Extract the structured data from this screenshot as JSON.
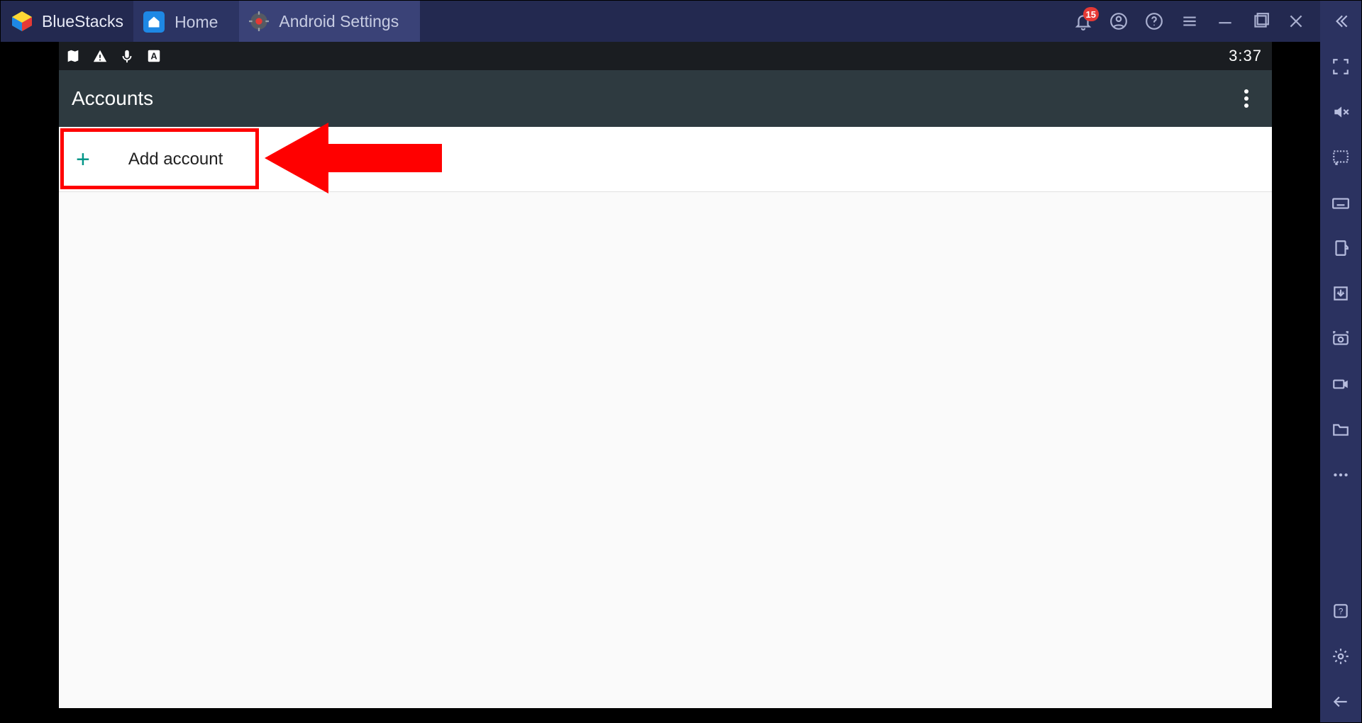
{
  "app": {
    "name": "BlueStacks"
  },
  "tabs": {
    "home_label": "Home",
    "settings_label": "Android Settings"
  },
  "titlebar": {
    "notification_count": "15"
  },
  "android": {
    "status_time": "3:37",
    "header_title": "Accounts",
    "add_account_label": "Add account"
  }
}
